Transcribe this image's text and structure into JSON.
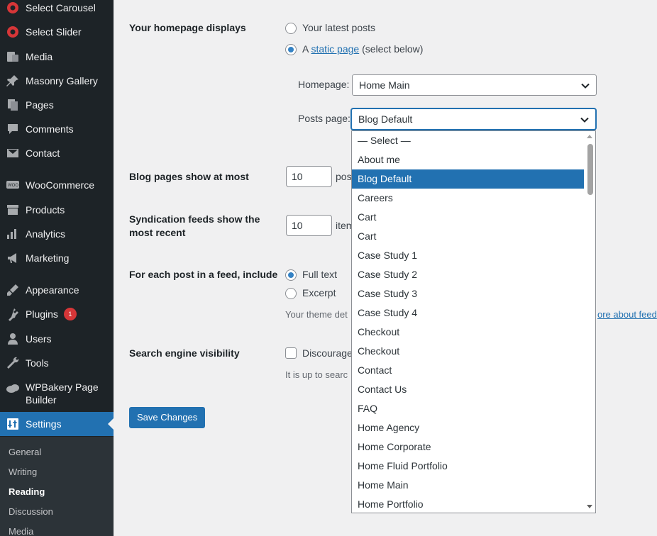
{
  "sidebar": {
    "items": [
      {
        "label": "Select Carousel",
        "icon": "select-carousel-icon"
      },
      {
        "label": "Select Slider",
        "icon": "select-slider-icon"
      },
      {
        "label": "Media",
        "icon": "media-icon"
      },
      {
        "label": "Masonry Gallery",
        "icon": "pin-icon"
      },
      {
        "label": "Pages",
        "icon": "pages-icon"
      },
      {
        "label": "Comments",
        "icon": "comments-icon"
      },
      {
        "label": "Contact",
        "icon": "mail-icon"
      },
      {
        "label": "WooCommerce",
        "icon": "woocommerce-icon"
      },
      {
        "label": "Products",
        "icon": "products-icon"
      },
      {
        "label": "Analytics",
        "icon": "analytics-icon"
      },
      {
        "label": "Marketing",
        "icon": "megaphone-icon"
      },
      {
        "label": "Appearance",
        "icon": "brush-icon"
      },
      {
        "label": "Plugins",
        "icon": "plugins-icon",
        "badge": "1"
      },
      {
        "label": "Users",
        "icon": "users-icon"
      },
      {
        "label": "Tools",
        "icon": "wrench-icon"
      },
      {
        "label": "WPBakery Page Builder",
        "icon": "wpbakery-icon"
      },
      {
        "label": "Settings",
        "icon": "settings-icon"
      }
    ],
    "submenu": [
      "General",
      "Writing",
      "Reading",
      "Discussion",
      "Media"
    ],
    "current_sub": "Reading"
  },
  "homepage_displays": {
    "label": "Your homepage displays",
    "option_latest": "Your latest posts",
    "option_static_prefix": "A",
    "option_static_link": "static page",
    "option_static_suffix": "(select below)",
    "homepage_label": "Homepage:",
    "homepage_value": "Home Main",
    "posts_page_label": "Posts page:",
    "posts_page_value": "Blog Default"
  },
  "blog_pages": {
    "label": "Blog pages show at most",
    "value": "10",
    "suffix_visible": "pos"
  },
  "syndication": {
    "label": "Syndication feeds show the most recent",
    "value": "10",
    "suffix_visible": "item"
  },
  "feed_include": {
    "label": "For each post in a feed, include",
    "option_full": "Full text",
    "option_excerpt": "Excerpt",
    "desc_left": "Your theme det",
    "desc_right": "ore about feed"
  },
  "search_visibility": {
    "label": "Search engine visibility",
    "checkbox_label": "Discourage",
    "desc": "It is up to searc"
  },
  "save_button": "Save Changes",
  "dropdown": {
    "options": [
      "— Select —",
      "About me",
      "Blog Default",
      "Careers",
      "Cart",
      "Cart",
      "Case Study 1",
      "Case Study 2",
      "Case Study 3",
      "Case Study 4",
      "Checkout",
      "Checkout",
      "Contact",
      "Contact Us",
      "FAQ",
      "Home Agency",
      "Home Corporate",
      "Home Fluid Portfolio",
      "Home Main",
      "Home Portfolio"
    ],
    "selected_index": 2
  },
  "colors": {
    "sidebar_bg": "#1d2327",
    "accent": "#2271b1",
    "page_bg": "#f0f0f1",
    "badge": "#d63638"
  }
}
